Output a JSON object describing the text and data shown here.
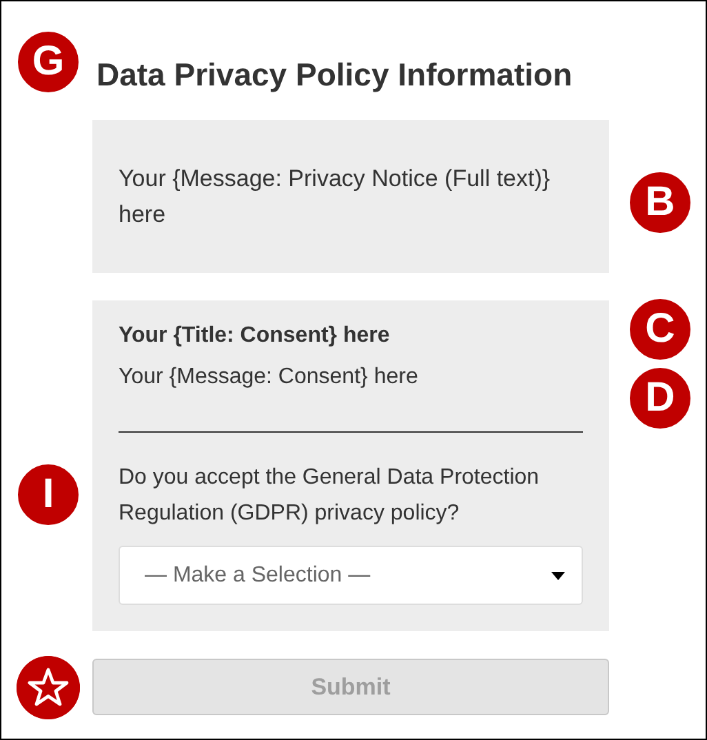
{
  "heading": {
    "text": "Data Privacy Policy Information",
    "badge": "G"
  },
  "notice": {
    "text": "Your {Message: Privacy Notice (Full text)} here",
    "badge": "B"
  },
  "consent": {
    "title": "Your {Title: Consent} here",
    "title_badge": "C",
    "message": "Your {Message: Consent} here",
    "message_badge": "D",
    "question": "Do you accept the General Data Protection Regulation (GDPR) privacy policy?",
    "question_badge": "I",
    "select": {
      "placeholder": "— Make a Selection —"
    }
  },
  "submit": {
    "label": "Submit",
    "disabled": true,
    "star_badge": true
  }
}
